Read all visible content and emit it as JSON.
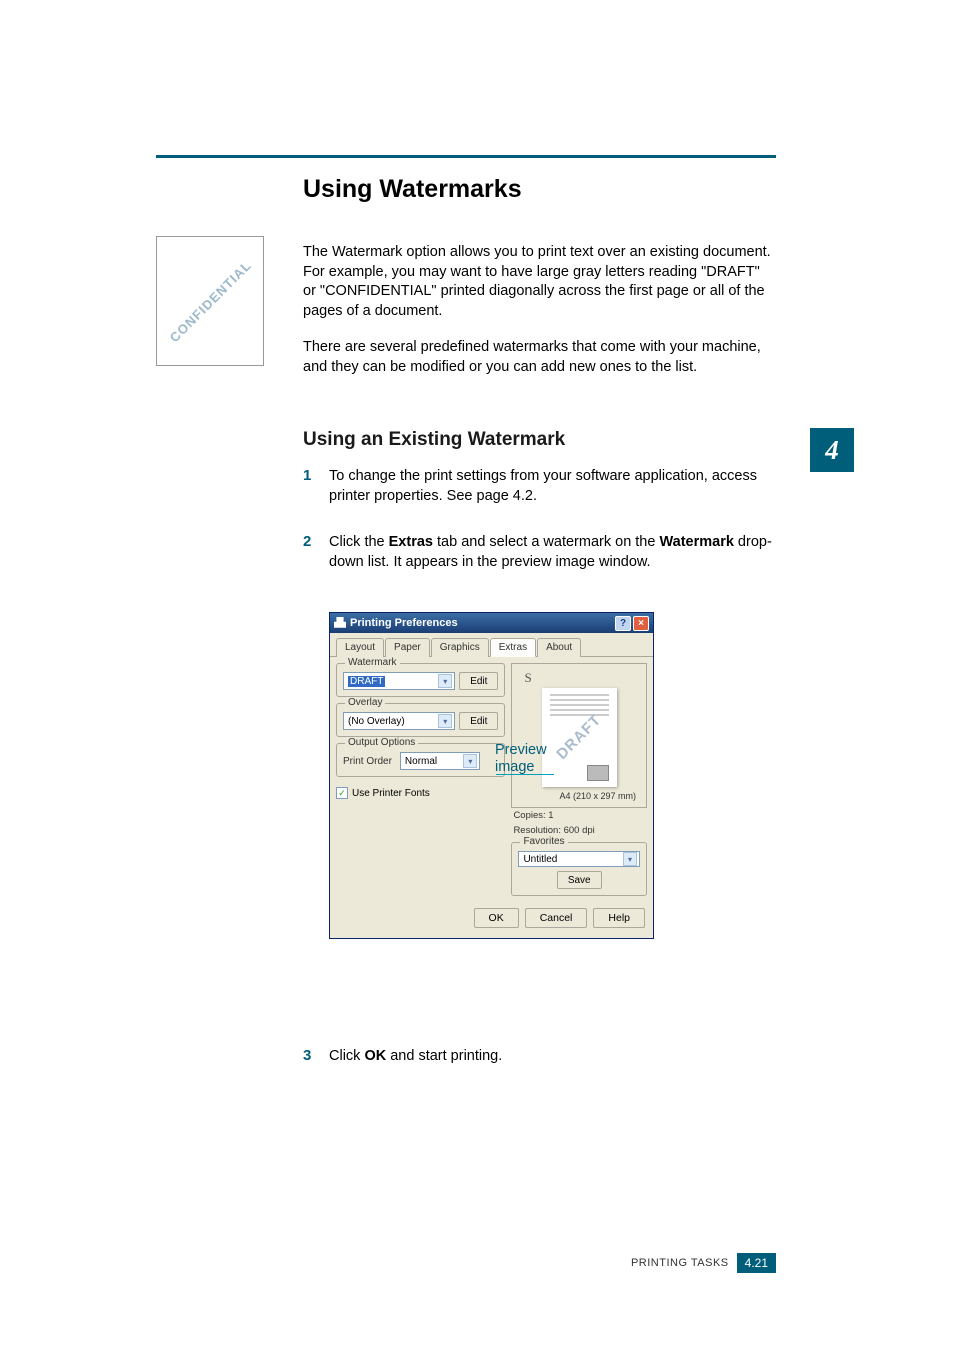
{
  "section": {
    "title": "Using Watermarks"
  },
  "paragraphs": {
    "p1": "The Watermark option allows you to print text over an existing document. For example, you may want to have large gray letters reading \"DRAFT\" or \"CONFIDENTIAL\" printed diagonally across the first page or all of the pages of a document.",
    "p2": "There are several predefined watermarks that come with your machine, and they can be modified or you can add new ones to the list."
  },
  "sidebar_image": {
    "text": "CONFIDENTIAL"
  },
  "subsection": {
    "title": "Using an Existing Watermark"
  },
  "chapter": {
    "number": "4"
  },
  "steps": {
    "s1": {
      "num": "1",
      "text_before": "To change the print settings from your software application, access printer properties. See ",
      "link": "page 4.2",
      "text_after": "."
    },
    "s2": {
      "num": "2",
      "text_a": "Click the ",
      "bold_a": "Extras",
      "text_b": " tab and select a watermark on the ",
      "bold_b": "Watermark",
      "text_c": " drop-down list. It appears in the preview image window."
    },
    "s3": {
      "num": "3",
      "text_a": "Click ",
      "bold_a": "OK",
      "text_b": " and start printing."
    }
  },
  "annotation": {
    "line1": "Preview",
    "line2": "image"
  },
  "dialog": {
    "title": "Printing Preferences",
    "help_btn": "?",
    "close_btn": "×",
    "tabs": {
      "layout": "Layout",
      "paper": "Paper",
      "graphics": "Graphics",
      "extras": "Extras",
      "about": "About"
    },
    "groups": {
      "watermark": {
        "title": "Watermark",
        "value": "DRAFT",
        "edit": "Edit"
      },
      "overlay": {
        "title": "Overlay",
        "value": "(No Overlay)",
        "edit": "Edit"
      },
      "output": {
        "title": "Output Options",
        "label": "Print Order",
        "value": "Normal"
      },
      "printer_fonts": "Use Printer Fonts"
    },
    "preview": {
      "s_letter": "S",
      "watermark_text": "DRAFT",
      "paper_size": "A4 (210 x 297 mm)"
    },
    "info": {
      "copies": "Copies: 1",
      "resolution": "Resolution: 600 dpi"
    },
    "favorites": {
      "title": "Favorites",
      "value": "Untitled",
      "save": "Save"
    },
    "buttons": {
      "ok": "OK",
      "cancel": "Cancel",
      "help": "Help"
    }
  },
  "footer": {
    "label": "PRINTING TASKS",
    "page": "4.21"
  }
}
